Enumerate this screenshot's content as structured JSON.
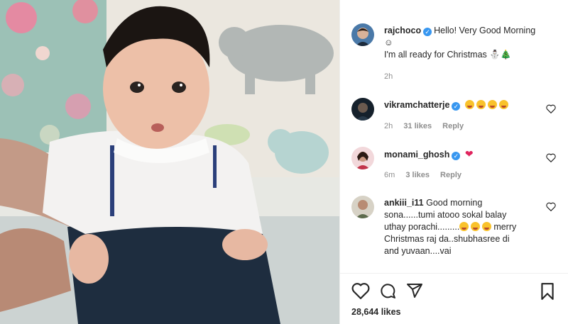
{
  "post": {
    "username": "rajchoco",
    "caption_line1": "Hello! Very Good Morning",
    "caption_line2": "☺",
    "caption_line3": "I'm all ready for Christmas",
    "caption_emoji": "⛄🎄",
    "time": "2h"
  },
  "comments": [
    {
      "username": "vikramchatterje",
      "time": "2h",
      "likes": "31 likes",
      "reply": "Reply"
    },
    {
      "username": "monami_ghosh",
      "time": "6m",
      "likes": "3 likes",
      "reply": "Reply"
    },
    {
      "username": "ankiii_i11",
      "text_line1": "Good morning",
      "text_line2": "sona......tumi atooo sokal balay",
      "text_line3": "uthay porachi.........",
      "text_line3_tail": "merry",
      "text_line4": "Christmas raj da..shubhasree di",
      "text_line5": "and yuvaan....vai"
    }
  ],
  "footer": {
    "likes_count": "28,644 likes"
  },
  "icons": {
    "like": "heart-icon",
    "comment": "comment-bubble-icon",
    "share": "paper-plane-icon",
    "save": "bookmark-icon"
  },
  "colors": {
    "verified": "#3897f0",
    "muted_text": "#8e8e8e",
    "text": "#262626"
  }
}
